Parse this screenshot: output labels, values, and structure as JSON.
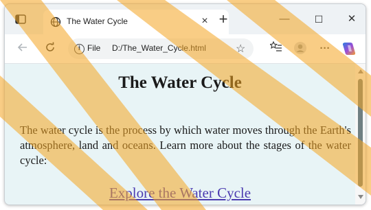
{
  "browser": {
    "tab": {
      "title": "The Water Cycle",
      "close_glyph": "×"
    },
    "new_tab_glyph": "+",
    "window_controls": {
      "minimize": "—",
      "maximize": "☐",
      "close": "✕"
    },
    "address_bar": {
      "scheme_label": "File",
      "url": "D:/The_Water_Cycle.html"
    }
  },
  "page": {
    "heading": "The Water Cycle",
    "paragraph": "The water cycle is the process by which water moves through the Earth's atmosphere, land and oceans. Learn more about the stages of the water cycle:",
    "link": "Explore the Water Cycle"
  },
  "colors": {
    "page_background": "#e8f4f6",
    "link": "#4b3bb0",
    "heading": "#1a1a1a",
    "watermark": "#f5a623"
  },
  "icons": {
    "tab_actions": "tab-actions-icon",
    "globe": "globe-icon",
    "back": "back-arrow-icon",
    "reload": "reload-icon",
    "info": "info-icon",
    "favorite": "star-icon",
    "favorites_list": "favorites-list-icon",
    "profile": "profile-icon",
    "more": "more-icon",
    "copilot": "copilot-icon"
  }
}
